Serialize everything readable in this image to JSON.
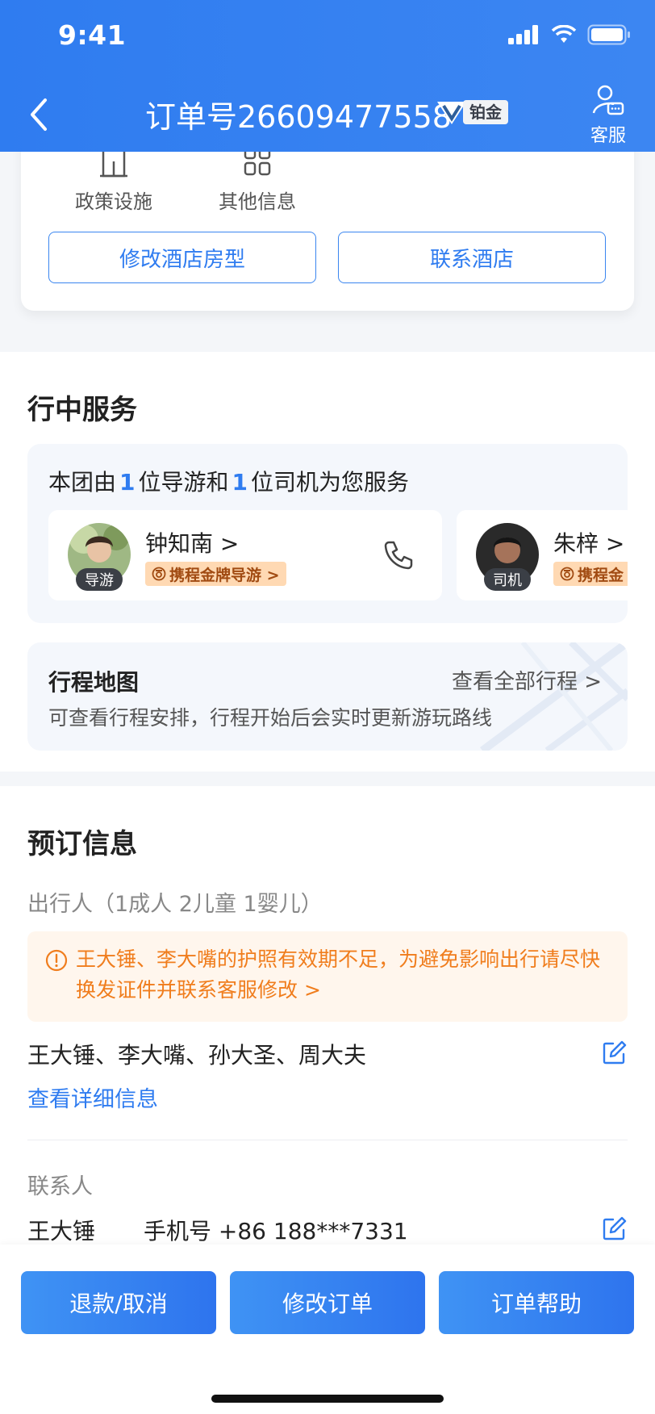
{
  "status": {
    "time": "9:41"
  },
  "nav": {
    "title": "订单号26609477558",
    "badge": "铂金",
    "service_label": "客服"
  },
  "hotel": {
    "icons": [
      {
        "label": "政策设施",
        "icon": "building-icon"
      },
      {
        "label": "其他信息",
        "icon": "grid-icon"
      }
    ],
    "modify_button": "修改酒店房型",
    "contact_button": "联系酒店"
  },
  "trip_service": {
    "title": "行中服务",
    "summary_prefix": "本团由",
    "guide_count": "1",
    "summary_mid": "位导游和",
    "driver_count": "1",
    "summary_suffix": "位司机为您服务",
    "people": [
      {
        "name": "钟知南 >",
        "role": "导游",
        "badge": "携程金牌导游 >"
      },
      {
        "name": "朱梓 >",
        "role": "司机",
        "badge": "携程金"
      }
    ],
    "map": {
      "title": "行程地图",
      "link": "查看全部行程 >",
      "desc": "可查看行程安排，行程开始后会实时更新游玩路线"
    }
  },
  "booking": {
    "title": "预订信息",
    "travelers_label": "出行人（1成人 2儿童 1婴儿）",
    "warning": "王大锤、李大嘴的护照有效期不足，为避免影响出行请尽快换发证件并联系客服修改 >",
    "travelers": "王大锤、李大嘴、孙大圣、周大夫",
    "details_link": "查看详细信息",
    "contact_label": "联系人",
    "contact_name": "王大锤",
    "contact_phone": "手机号 +86 188***7331"
  },
  "actions": {
    "refund": "退款/取消",
    "modify": "修改订单",
    "help": "订单帮助"
  }
}
